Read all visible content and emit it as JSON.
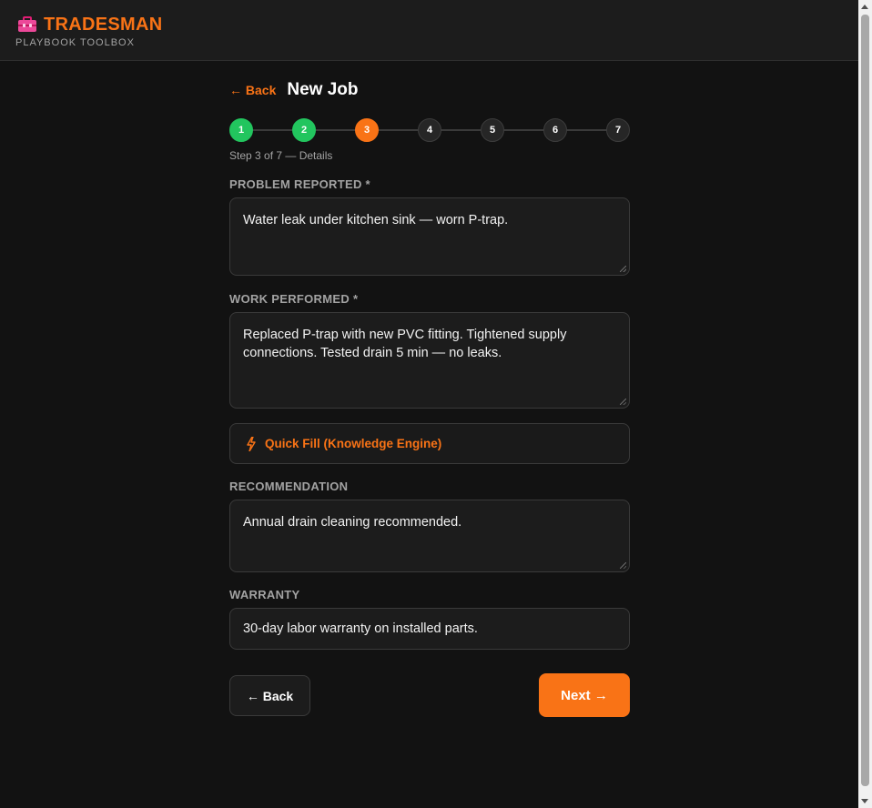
{
  "header": {
    "brand_icon": "toolbox-icon",
    "brand_name": "TRADESMAN",
    "brand_subtitle": "PLAYBOOK TOOLBOX"
  },
  "nav": {
    "back_label": "← Back",
    "page_title": "New Job"
  },
  "stepper": {
    "steps": [
      "1",
      "2",
      "3",
      "4",
      "5",
      "6",
      "7"
    ],
    "current_step": 3,
    "caption": "Step 3 of 7 — Details"
  },
  "form": {
    "problem_label": "PROBLEM REPORTED *",
    "problem_value": "Water leak under kitchen sink — worn P-trap.",
    "work_label": "WORK PERFORMED *",
    "work_value": "Replaced P-trap with new PVC fitting. Tightened supply connections. Tested drain 5 min — no leaks.",
    "quick_fill_label": "Quick Fill (Knowledge Engine)",
    "quick_fill_icon": "lightning-bolt-icon",
    "recommendation_label": "RECOMMENDATION",
    "recommendation_value": "Annual drain cleaning recommended.",
    "warranty_label": "WARRANTY",
    "warranty_value": "30-day labor warranty on installed parts."
  },
  "actions": {
    "back_label": "← Back",
    "next_label": "Next →"
  },
  "colors": {
    "accent": "#f97316",
    "done": "#22c55e",
    "background": "#121212"
  }
}
